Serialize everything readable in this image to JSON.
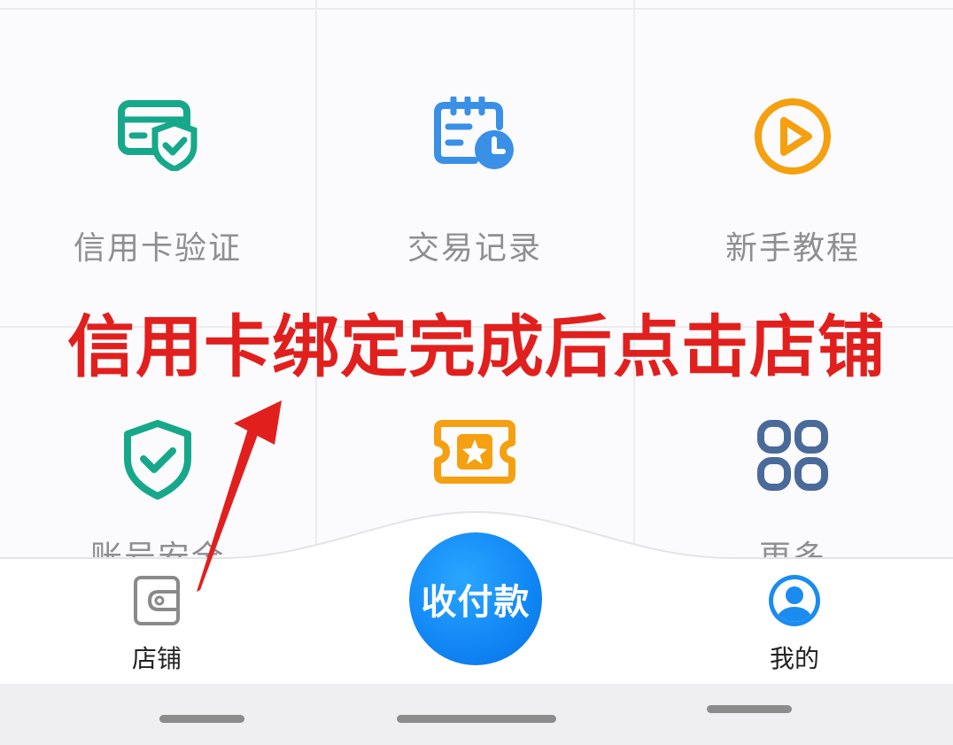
{
  "grid": {
    "row1": [
      {
        "label": "信用卡验证",
        "icon": "card-shield-icon",
        "color": "#17a88b"
      },
      {
        "label": "交易记录",
        "icon": "calendar-clock-icon",
        "color": "#3a8fe6"
      },
      {
        "label": "新手教程",
        "icon": "play-circle-icon",
        "color": "#f5a010"
      }
    ],
    "row2": [
      {
        "label": "账号安全",
        "icon": "shield-check-icon",
        "color": "#17a88b"
      },
      {
        "label": "",
        "icon": "ticket-star-icon",
        "color": "#f5a010"
      },
      {
        "label": "更多",
        "icon": "grid-four-icon",
        "color": "#4a6a9a"
      }
    ]
  },
  "annotation": {
    "text": "信用卡绑定完成后点击店铺",
    "color": "#e1201e"
  },
  "tabbar": {
    "store_label": "店铺",
    "store_icon": "wallet-icon",
    "pay_label": "收付款",
    "pay_color": "#1086f5",
    "mine_label": "我的",
    "mine_icon": "user-avatar-icon"
  }
}
